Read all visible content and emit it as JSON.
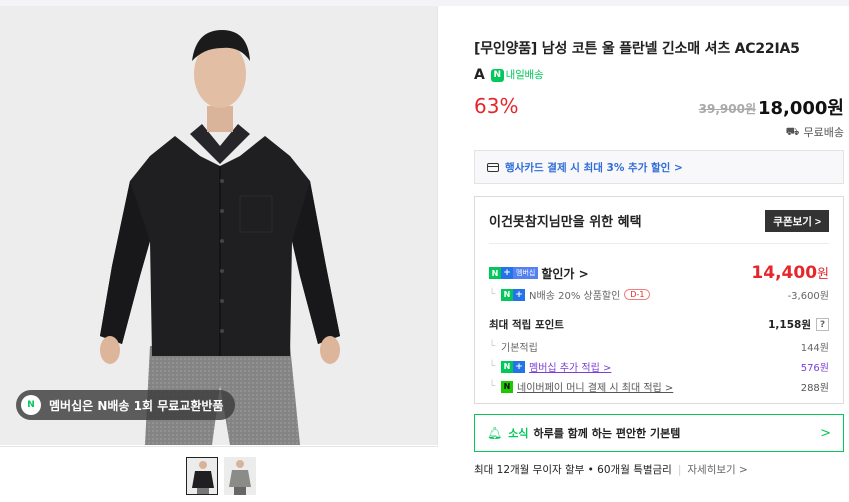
{
  "product": {
    "title_line1": "[무인양품] 남성 코튼 울 플란넬 긴소매 셔츠 AC22IA5",
    "title_line2": "A",
    "delivery_badge": "내일배송",
    "discount_rate": "63%",
    "original_price": "39,900원",
    "sale_price": "18,000원",
    "shipping": "무료배송"
  },
  "image": {
    "benefit_pill": "멤버십은 N배송 1회 무료교환반품",
    "benefit_pill_icon": "N"
  },
  "card_promo": {
    "text": "행사카드 결제 시 최대 3% 추가 할인 >"
  },
  "benefits": {
    "heading": "이건못참지님만을 위한 혜택",
    "coupon_button": "쿠폰보기 >",
    "sale_label": "할인가 >",
    "membership_tag": "멤버십",
    "sale_price": "14,400",
    "sale_price_unit": "원",
    "n_delivery_discount": "N배송 20% 상품할인",
    "d_day": "D-1",
    "n_delivery_amount": "-3,600원",
    "points_title": "최대 적립 포인트",
    "points_total": "1,158원",
    "points_help": "?",
    "basic_label": "기본적립",
    "basic_value": "144원",
    "membership_label": "멤버십 추가 적립 >",
    "membership_value": "576원",
    "naverpay_label": "네이버페이 머니 결제 시 최대 적립 >",
    "naverpay_value": "288원"
  },
  "news": {
    "tag": "소식",
    "text": "하루를 함께 하는 편안한 기본템",
    "chevron": ">"
  },
  "installment": {
    "text": "최대 12개월 무이자 할부 • 60개월 특별금리",
    "more": "자세히보기 >"
  },
  "icons": [
    "truck-icon",
    "card-icon",
    "bell-icon",
    "chevron-right-icon",
    "naver-pay-icon",
    "n-plus-icon"
  ],
  "colors": {
    "accent_green": "#03c75a",
    "sale_red": "#e5272c",
    "promo_blue": "#2f6cd9",
    "membership_purple": "#7b3fd6"
  }
}
